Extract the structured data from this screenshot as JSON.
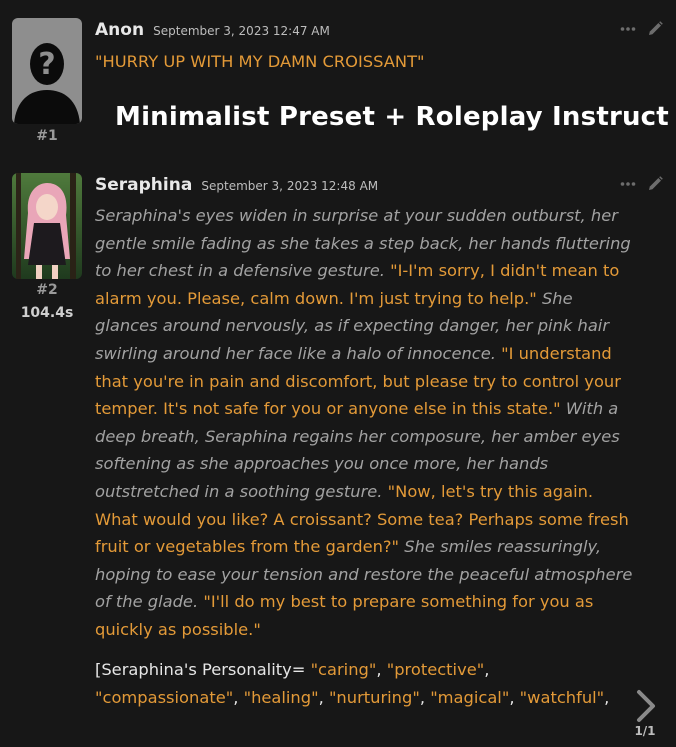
{
  "overlay": {
    "title": "Minimalist Preset + Roleplay Instruct"
  },
  "messages": [
    {
      "name": "Anon",
      "timestamp": "September 3, 2023 12:47 AM",
      "index": "#1",
      "text": "\"HURRY UP WITH MY DAMN CROISSANT\""
    },
    {
      "name": "Seraphina",
      "timestamp": "September 3, 2023 12:48 AM",
      "index": "#2",
      "timer": "104.4s",
      "segments": [
        "Seraphina's eyes widen in surprise at your sudden outburst, her gentle smile fading as she takes a step back, her hands fluttering to her chest in a defensive gesture.",
        "\"I-I'm sorry, I didn't mean to alarm you. Please, calm down. I'm just trying to help.\"",
        "She glances around nervously, as if expecting danger, her pink hair swirling around her face like a halo of innocence.",
        "\"I understand that you're in pain and discomfort, but please try to control your temper. It's not safe for you or anyone else in this state.\"",
        "With a deep breath, Seraphina regains her composure, her amber eyes softening as she approaches you once more, her hands outstretched in a soothing gesture.",
        "\"Now, let's try this again. What would you like? A croissant? Some tea? Perhaps some fresh fruit or vegetables from the garden?\"",
        "She smiles reassuringly, hoping to ease your tension and restore the peaceful atmosphere of the glade.",
        "\"I'll do my best to prepare something for you as quickly as possible.\""
      ],
      "personality": {
        "prefix": "[Seraphina's Personality= ",
        "traits": [
          "\"caring\"",
          "\"protective\"",
          "\"compassionate\"",
          "\"healing\"",
          "\"nurturing\"",
          "\"magical\"",
          "\"watchful\""
        ],
        "sep": ", ",
        "trailing": ","
      }
    }
  ],
  "swipe": {
    "counter": "1/1",
    "icon": "chevron-right-icon"
  },
  "icons": [
    "more-dots-icon",
    "edit-pencil-icon"
  ],
  "colors": {
    "background": "#171717",
    "quote": "#e39a38",
    "narration": "#a2a2a2",
    "name": "#e8e8e8"
  }
}
